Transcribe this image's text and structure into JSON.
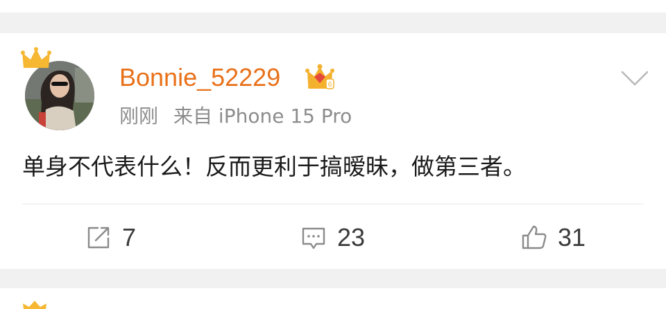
{
  "colors": {
    "username": "#e8711a",
    "meta": "#8c8c8c",
    "text": "#1a1a1a",
    "icon": "#8a8a8a",
    "count": "#3a3a3a",
    "crown": "#f6b733",
    "background": "#f1f1f1"
  },
  "post": {
    "username": "Bonnie_52229",
    "time": "刚刚",
    "source": "来自 iPhone 15 Pro",
    "text": "单身不代表什么！反而更利于搞暧昧，做第三者。"
  },
  "actions": {
    "repost": {
      "icon": "repost-icon",
      "count": "7"
    },
    "comment": {
      "icon": "comment-icon",
      "count": "23"
    },
    "like": {
      "icon": "thumbs-up-icon",
      "count": "31"
    }
  }
}
